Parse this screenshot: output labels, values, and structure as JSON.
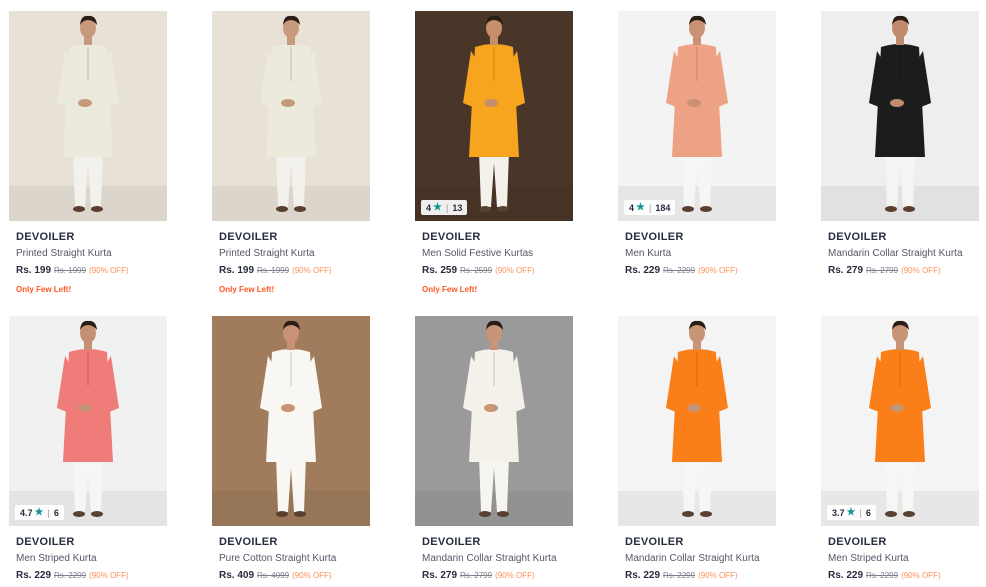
{
  "products": [
    {
      "brand": "DEVOILER",
      "title": "Printed Straight Kurta",
      "price": "Rs. 199",
      "mrp": "Rs. 1999",
      "discount": "(90% OFF)",
      "stock": "Only Few Left!",
      "rating": "",
      "rating_count": "",
      "bg": "#e8e1d6",
      "kurta": "#ece9dd",
      "pants": "#f2f1ec",
      "skin": "#c79a7d"
    },
    {
      "brand": "DEVOILER",
      "title": "Printed Straight Kurta",
      "price": "Rs. 199",
      "mrp": "Rs. 1999",
      "discount": "(90% OFF)",
      "stock": "Only Few Left!",
      "rating": "",
      "rating_count": "",
      "bg": "#e8e1d6",
      "kurta": "#ece9dd",
      "pants": "#f2f1ec",
      "skin": "#c79a7d"
    },
    {
      "brand": "DEVOILER",
      "title": "Men Solid Festive Kurtas",
      "price": "Rs. 259",
      "mrp": "Rs. 2599",
      "discount": "(90% OFF)",
      "stock": "Only Few Left!",
      "rating": "4",
      "rating_count": "13",
      "bg": "#4a3628",
      "kurta": "#f7a41e",
      "pants": "#f3f1ea",
      "skin": "#c68e6a"
    },
    {
      "brand": "DEVOILER",
      "title": "Men Kurta",
      "price": "Rs. 229",
      "mrp": "Rs. 2299",
      "discount": "(90% OFF)",
      "stock": "",
      "rating": "4",
      "rating_count": "184",
      "bg": "#f3f3f3",
      "kurta": "#eea285",
      "pants": "#f6f6f4",
      "skin": "#c99274"
    },
    {
      "brand": "DEVOILER",
      "title": "Mandarin Collar Straight Kurta",
      "price": "Rs. 279",
      "mrp": "Rs. 2799",
      "discount": "(90% OFF)",
      "stock": "",
      "rating": "",
      "rating_count": "",
      "bg": "#eeeeee",
      "kurta": "#1c1c1c",
      "pants": "#f4f4f2",
      "skin": "#c08a6e"
    },
    {
      "brand": "DEVOILER",
      "title": "Men Striped Kurta",
      "price": "Rs. 229",
      "mrp": "Rs. 2299",
      "discount": "(90% OFF)",
      "stock": "",
      "rating": "4.7",
      "rating_count": "6",
      "bg": "#f1f1f1",
      "kurta": "#ef7c78",
      "pants": "#f6f6f4",
      "skin": "#c69173"
    },
    {
      "brand": "DEVOILER",
      "title": "Pure Cotton Straight Kurta",
      "price": "Rs. 409",
      "mrp": "Rs. 4099",
      "discount": "(90% OFF)",
      "stock": "",
      "rating": "",
      "rating_count": "",
      "bg": "#a07c5c",
      "kurta": "#f8f7f3",
      "pants": "#f8f7f3",
      "skin": "#c99274"
    },
    {
      "brand": "DEVOILER",
      "title": "Mandarin Collar Straight Kurta",
      "price": "Rs. 279",
      "mrp": "Rs. 2799",
      "discount": "(90% OFF)",
      "stock": "",
      "rating": "",
      "rating_count": "",
      "bg": "#9a9a9a",
      "kurta": "#f3f1ea",
      "pants": "#f6f5f1",
      "skin": "#c89476"
    },
    {
      "brand": "DEVOILER",
      "title": "Mandarin Collar Straight Kurta",
      "price": "Rs. 229",
      "mrp": "Rs. 2299",
      "discount": "(90% OFF)",
      "stock": "",
      "rating": "",
      "rating_count": "",
      "bg": "#f4f4f4",
      "kurta": "#fb7f18",
      "pants": "#f6f6f4",
      "skin": "#c89476"
    },
    {
      "brand": "DEVOILER",
      "title": "Men Striped Kurta",
      "price": "Rs. 229",
      "mrp": "Rs. 2299",
      "discount": "(90% OFF)",
      "stock": "",
      "rating": "3.7",
      "rating_count": "6",
      "bg": "#f4f4f4",
      "kurta": "#fb7f18",
      "pants": "#f6f6f4",
      "skin": "#c89476"
    }
  ]
}
